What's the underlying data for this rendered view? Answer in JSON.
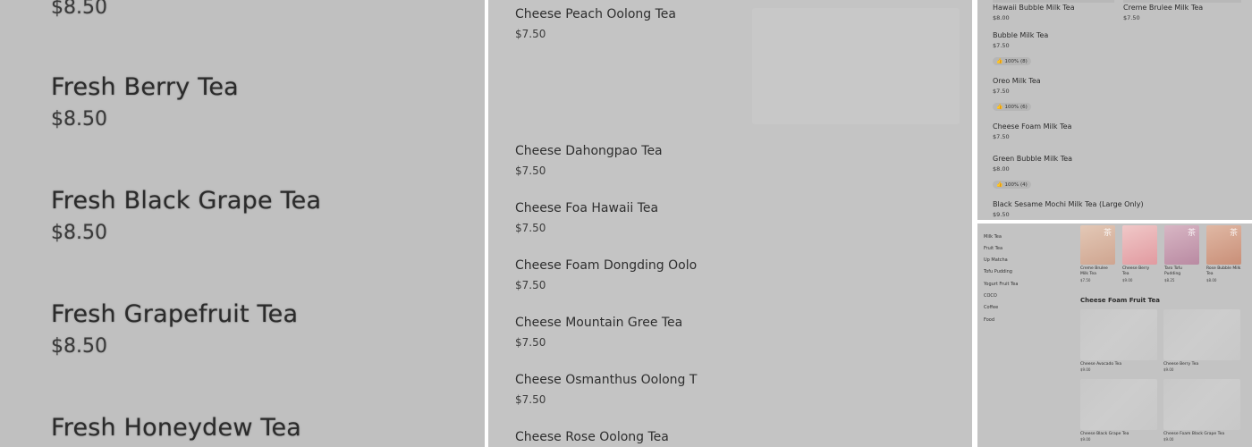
{
  "panel1": {
    "top_price": "$8.50",
    "items": [
      {
        "name": "Fresh Berry Tea",
        "price": "$8.50"
      },
      {
        "name": "Fresh Black Grape Tea",
        "price": "$8.50"
      },
      {
        "name": "Fresh Grapefruit Tea",
        "price": "$8.50"
      },
      {
        "name": "Fresh Honeydew Tea",
        "price": ""
      }
    ]
  },
  "panel2": {
    "items": [
      {
        "name": "Cheese Peach Oolong Tea",
        "price": "$7.50"
      },
      {
        "name": "Cheese Dahongpao Tea",
        "price": "$7.50"
      },
      {
        "name": "Cheese Foa Hawaii Tea",
        "price": "$7.50"
      },
      {
        "name": "Cheese Foam Dongding Oolo",
        "price": "$7.50"
      },
      {
        "name": "Cheese Mountain Gree Tea",
        "price": "$7.50"
      },
      {
        "name": "Cheese Osmanthus Oolong T",
        "price": "$7.50"
      },
      {
        "name": "Cheese Rose Oolong Tea",
        "price": ""
      }
    ]
  },
  "panel3": {
    "top_row": [
      {
        "name": "Hawaii Bubble Milk Tea",
        "price": "$8.00"
      },
      {
        "name": "Creme Brulee Milk Tea",
        "price": "$7.50"
      }
    ],
    "items": [
      {
        "name": "Bubble Milk Tea",
        "price": "$7.50",
        "badge": "100% (8)"
      },
      {
        "name": "Oreo Milk Tea",
        "price": "$7.50",
        "badge": "100% (6)"
      },
      {
        "name": "Cheese Foam Milk Tea",
        "price": "$7.50",
        "badge": ""
      },
      {
        "name": "Green Bubble Milk Tea",
        "price": "$8.00",
        "badge": "100% (4)"
      },
      {
        "name": "Black Sesame Mochi Milk Tea (Large Only)",
        "price": "$9.50",
        "badge": ""
      }
    ]
  },
  "panel4": {
    "categories": [
      "Milk Tea",
      "Fruit Tea",
      "Up Matcha",
      "Tofu Pudding",
      "Yogurt Fruit Tea",
      "COCO",
      "Coffee",
      "Food"
    ],
    "featured": [
      {
        "name": "Creme Brulee Milk Tea",
        "price": "$7.50",
        "color": "#d9b8a4"
      },
      {
        "name": "Cheese Berry Tea",
        "price": "$9.00",
        "color": "#e8b3b6"
      },
      {
        "name": "Taro Tofu Pudding",
        "price": "$8.25",
        "color": "#c9a2b4"
      },
      {
        "name": "Rose Bubble Milk Tea",
        "price": "$8.00",
        "color": "#d7a48f"
      }
    ],
    "section_title": "Cheese Foam Fruit Tea",
    "cards": [
      {
        "name": "Cheese Avocado Tea",
        "price": "$9.00"
      },
      {
        "name": "Cheese Berry Tea",
        "price": "$9.00"
      },
      {
        "name": "Cheese Black Grape Tea",
        "price": "$9.00"
      },
      {
        "name": "Cheese Foam Black Grape Tea",
        "price": "$9.00"
      }
    ]
  }
}
